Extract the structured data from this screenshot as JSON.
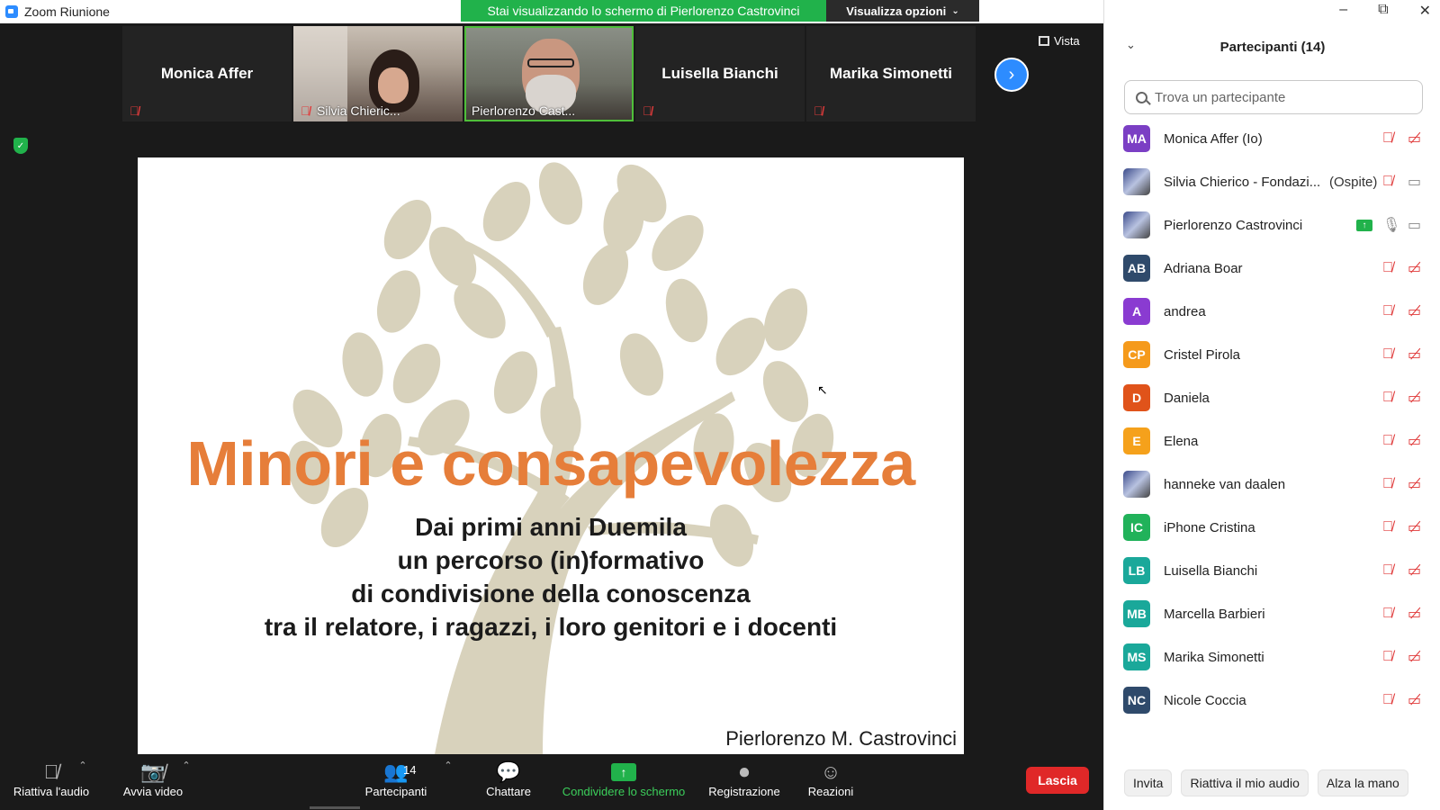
{
  "window": {
    "title": "Zoom Riunione",
    "share_banner": "Stai visualizzando lo schermo di Pierlorenzo Castrovinci",
    "view_options": "Visualizza opzioni",
    "vista": "Vista",
    "controls": [
      "–",
      "⧉",
      "✕"
    ]
  },
  "tiles": [
    {
      "name": "Monica Affer",
      "muted": true,
      "video": false
    },
    {
      "name": "Silvia Chieric...",
      "muted": true,
      "video": true
    },
    {
      "name": "Pierlorenzo Cast...",
      "muted": false,
      "video": true,
      "active": true
    },
    {
      "name": "Luisella Bianchi",
      "muted": true,
      "video": false
    },
    {
      "name": "Marika Simonetti",
      "muted": true,
      "video": false
    }
  ],
  "slide": {
    "title": "Minori e consapevolezza",
    "subtitle_lines": [
      "Dai primi anni Duemila",
      "un percorso (in)formativo",
      "di condivisione della conoscenza",
      "tra il relatore, i ragazzi, i loro genitori e i docenti"
    ],
    "author": "Pierlorenzo M. Castrovinci"
  },
  "toolbar": {
    "audio": "Riattiva l'audio",
    "video": "Avvia video",
    "participants": "Partecipanti",
    "participants_count": "14",
    "chat": "Chattare",
    "share": "Condividere lo schermo",
    "record": "Registrazione",
    "reactions": "Reazioni",
    "leave": "Lascia"
  },
  "panel": {
    "title": "Partecipanti (14)",
    "search_placeholder": "Trova un partecipante",
    "participants": [
      {
        "initials": "MA",
        "color": "#7b3fc4",
        "name": "Monica Affer (Io)",
        "tag": "",
        "mic": "off",
        "cam": "off"
      },
      {
        "initials": "",
        "color": "",
        "photo": true,
        "name": "Silvia Chierico - Fondazi...",
        "tag": "(Ospite)",
        "mic": "off",
        "cam": "on"
      },
      {
        "initials": "",
        "color": "",
        "photo": true,
        "name": "Pierlorenzo Castrovinci",
        "tag": "",
        "mic": "on",
        "cam": "on",
        "sharing": true
      },
      {
        "initials": "AB",
        "color": "#2f4a6b",
        "name": "Adriana Boar",
        "tag": "",
        "mic": "off",
        "cam": "off"
      },
      {
        "initials": "A",
        "color": "#8a3bd1",
        "name": "andrea",
        "tag": "",
        "mic": "off",
        "cam": "off"
      },
      {
        "initials": "CP",
        "color": "#f59a1b",
        "name": "Cristel Pirola",
        "tag": "",
        "mic": "off",
        "cam": "off"
      },
      {
        "initials": "D",
        "color": "#e0531a",
        "name": "Daniela",
        "tag": "",
        "mic": "off",
        "cam": "off"
      },
      {
        "initials": "E",
        "color": "#f5a11b",
        "name": "Elena",
        "tag": "",
        "mic": "off",
        "cam": "off"
      },
      {
        "initials": "",
        "color": "",
        "photo": true,
        "name": "hanneke van daalen",
        "tag": "",
        "mic": "off",
        "cam": "off"
      },
      {
        "initials": "IC",
        "color": "#21b25a",
        "name": "iPhone Cristina",
        "tag": "",
        "mic": "off",
        "cam": "off"
      },
      {
        "initials": "LB",
        "color": "#1aa89a",
        "name": "Luisella Bianchi",
        "tag": "",
        "mic": "off",
        "cam": "off"
      },
      {
        "initials": "MB",
        "color": "#1aa89a",
        "name": "Marcella Barbieri",
        "tag": "",
        "mic": "off",
        "cam": "off"
      },
      {
        "initials": "MS",
        "color": "#1aa89a",
        "name": "Marika Simonetti",
        "tag": "",
        "mic": "off",
        "cam": "off"
      },
      {
        "initials": "NC",
        "color": "#2f4a6b",
        "name": "Nicole Coccia",
        "tag": "",
        "mic": "off",
        "cam": "off"
      }
    ],
    "footer": {
      "invite": "Invita",
      "unmute_me": "Riattiva il mio audio",
      "raise_hand": "Alza la mano"
    }
  }
}
